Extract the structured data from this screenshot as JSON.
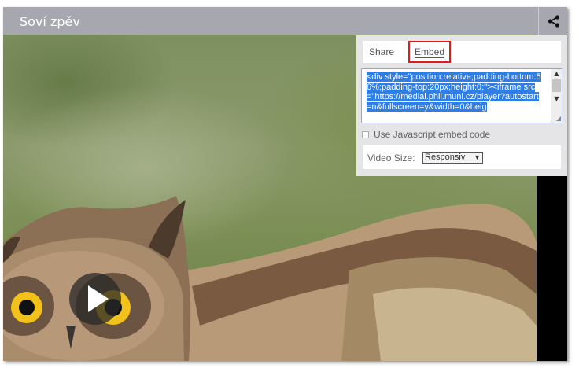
{
  "window": {
    "title": "Soví zpěv"
  },
  "toolbar": {
    "share_icon": "share-icon"
  },
  "player": {
    "play_icon": "play-icon"
  },
  "share_panel": {
    "tabs": [
      {
        "label": "Share",
        "active": false
      },
      {
        "label": "Embed",
        "active": true
      }
    ],
    "embed_code": "<div style=\"position:relative;padding-bottom:56%;padding-top:20px;height:0;\"><iframe src=\"https://medial.phil.muni.cz/player?autostart=n&fullscreen=y&width=0&heig",
    "js_embed_label": "Use Javascript embed code",
    "video_size_label": "Video Size:",
    "video_size_value": "Responsiv"
  },
  "colors": {
    "titlebar": "#a7a7af",
    "highlight": "#2f7ee6",
    "tab_outline": "#e11b1b"
  }
}
